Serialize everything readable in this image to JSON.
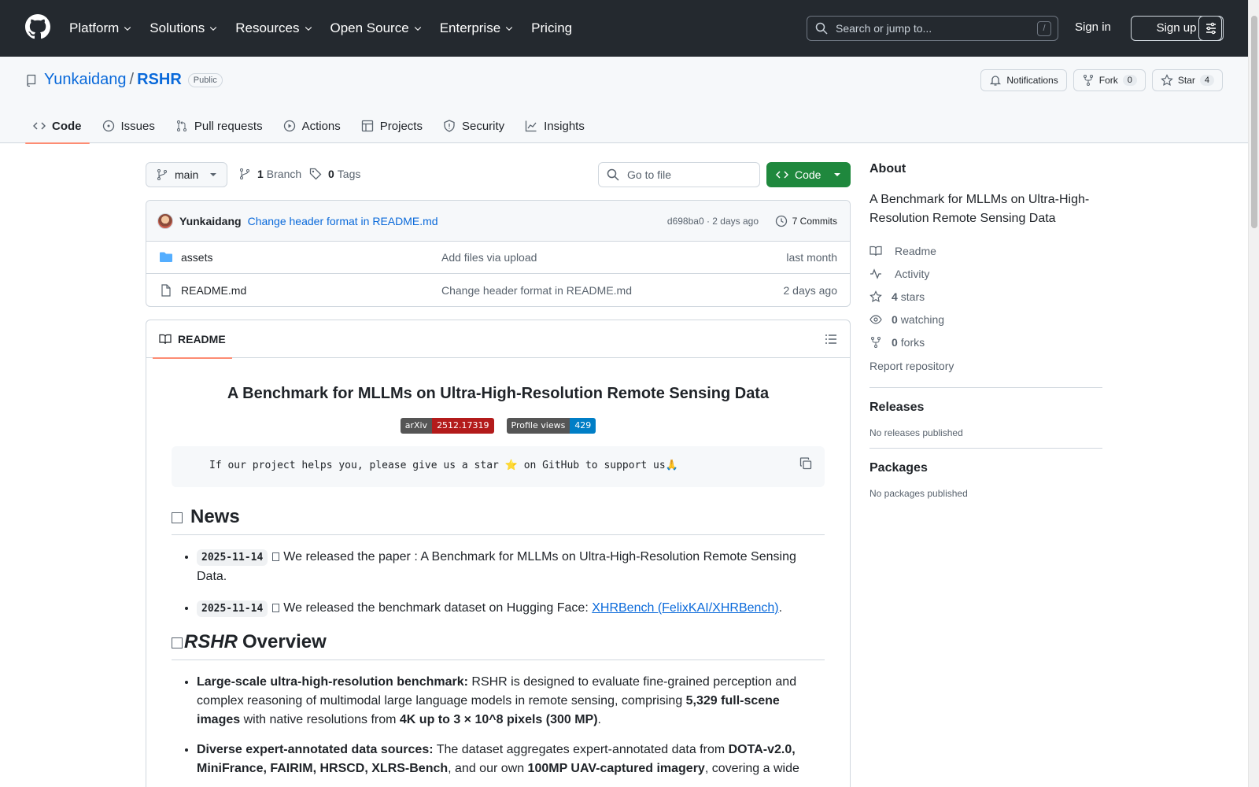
{
  "header": {
    "nav": [
      {
        "label": "Platform",
        "dropdown": true
      },
      {
        "label": "Solutions",
        "dropdown": true
      },
      {
        "label": "Resources",
        "dropdown": true
      },
      {
        "label": "Open Source",
        "dropdown": true
      },
      {
        "label": "Enterprise",
        "dropdown": true
      },
      {
        "label": "Pricing",
        "dropdown": false
      }
    ],
    "search_placeholder": "Search or jump to...",
    "search_shortcut": "/",
    "sign_in": "Sign in",
    "sign_up": "Sign up"
  },
  "repo": {
    "owner": "Yunkaidang",
    "separator": "/",
    "name": "RSHR",
    "visibility": "Public",
    "notifications_label": "Notifications",
    "fork_label": "Fork",
    "fork_count": "0",
    "star_label": "Star",
    "star_count": "4",
    "tabs": [
      {
        "label": "Code",
        "icon": "code-icon",
        "active": true
      },
      {
        "label": "Issues",
        "icon": "issue-icon",
        "active": false
      },
      {
        "label": "Pull requests",
        "icon": "pull-request-icon",
        "active": false
      },
      {
        "label": "Actions",
        "icon": "play-icon",
        "active": false
      },
      {
        "label": "Projects",
        "icon": "table-icon",
        "active": false
      },
      {
        "label": "Security",
        "icon": "shield-icon",
        "active": false
      },
      {
        "label": "Insights",
        "icon": "graph-icon",
        "active": false
      }
    ]
  },
  "toolbar": {
    "branch": "main",
    "branch_count": "1",
    "branch_label": "Branch",
    "tag_count": "0",
    "tag_label": "Tags",
    "goto_placeholder": "Go to file",
    "code_button": "Code"
  },
  "latest_commit": {
    "author": "Yunkaidang",
    "message": "Change header format in README.md",
    "hash_time": "d698ba0 · 2 days ago",
    "commits": "7 Commits"
  },
  "files": [
    {
      "name": "assets",
      "type": "folder",
      "message": "Add files via upload",
      "date": "last month"
    },
    {
      "name": "README.md",
      "type": "file",
      "message": "Change header format in README.md",
      "date": "2 days ago"
    }
  ],
  "readme": {
    "tab_label": "README",
    "title": "A Benchmark for MLLMs on Ultra-High-Resolution Remote Sensing Data",
    "badges": [
      {
        "left": "arXiv",
        "right": "2512.17319",
        "color": "#b31b1b"
      },
      {
        "left": "Profile views",
        "right": "429",
        "color": "#007ec6"
      }
    ],
    "star_note": "If our project helps you, please give us a star ⭐ on GitHub to support us🙏",
    "news_heading": "News",
    "news": [
      {
        "date": "2025-11-14",
        "text": "We released the paper : A Benchmark for MLLMs on Ultra-High-Resolution Remote Sensing Data.",
        "link": "",
        "tail": ""
      },
      {
        "date": "2025-11-14",
        "text": "We released the benchmark dataset on Hugging Face: ",
        "link": "XHRBench (FelixKAI/XHRBench)",
        "tail": "."
      }
    ],
    "overview_heading_em": "RSHR",
    "overview_heading": "Overview",
    "overview": [
      {
        "bold": "Large-scale ultra-high-resolution benchmark:",
        "t1": " RSHR is designed to evaluate fine-grained perception and complex reasoning of multimodal large language models in remote sensing, comprising ",
        "b2": "5,329 full-scene images",
        "t2": " with native resolutions from ",
        "b3": "4K up to 3 × 10^8 pixels (300 MP)",
        "t3": "."
      },
      {
        "bold": "Diverse expert-annotated data sources:",
        "t1": " The dataset aggregates expert-annotated data from ",
        "b2": "DOTA-v2.0, MiniFrance, FAIRIM, HRSCD, XLRS-Bench",
        "t2": ", and our own ",
        "b3": "100MP UAV-captured imagery",
        "t3": ", covering a wide"
      }
    ]
  },
  "sidebar": {
    "about_heading": "About",
    "description": "A Benchmark for MLLMs on Ultra-High-Resolution Remote Sensing Data",
    "items": [
      {
        "icon": "book-icon",
        "count": "",
        "label": "Readme"
      },
      {
        "icon": "pulse-icon",
        "count": "",
        "label": "Activity"
      },
      {
        "icon": "star-icon",
        "count": "4",
        "label": "stars"
      },
      {
        "icon": "eye-icon",
        "count": "0",
        "label": "watching"
      },
      {
        "icon": "fork-icon",
        "count": "0",
        "label": "forks"
      }
    ],
    "report": "Report repository",
    "releases_heading": "Releases",
    "releases_note": "No releases published",
    "packages_heading": "Packages",
    "packages_note": "No packages published"
  }
}
